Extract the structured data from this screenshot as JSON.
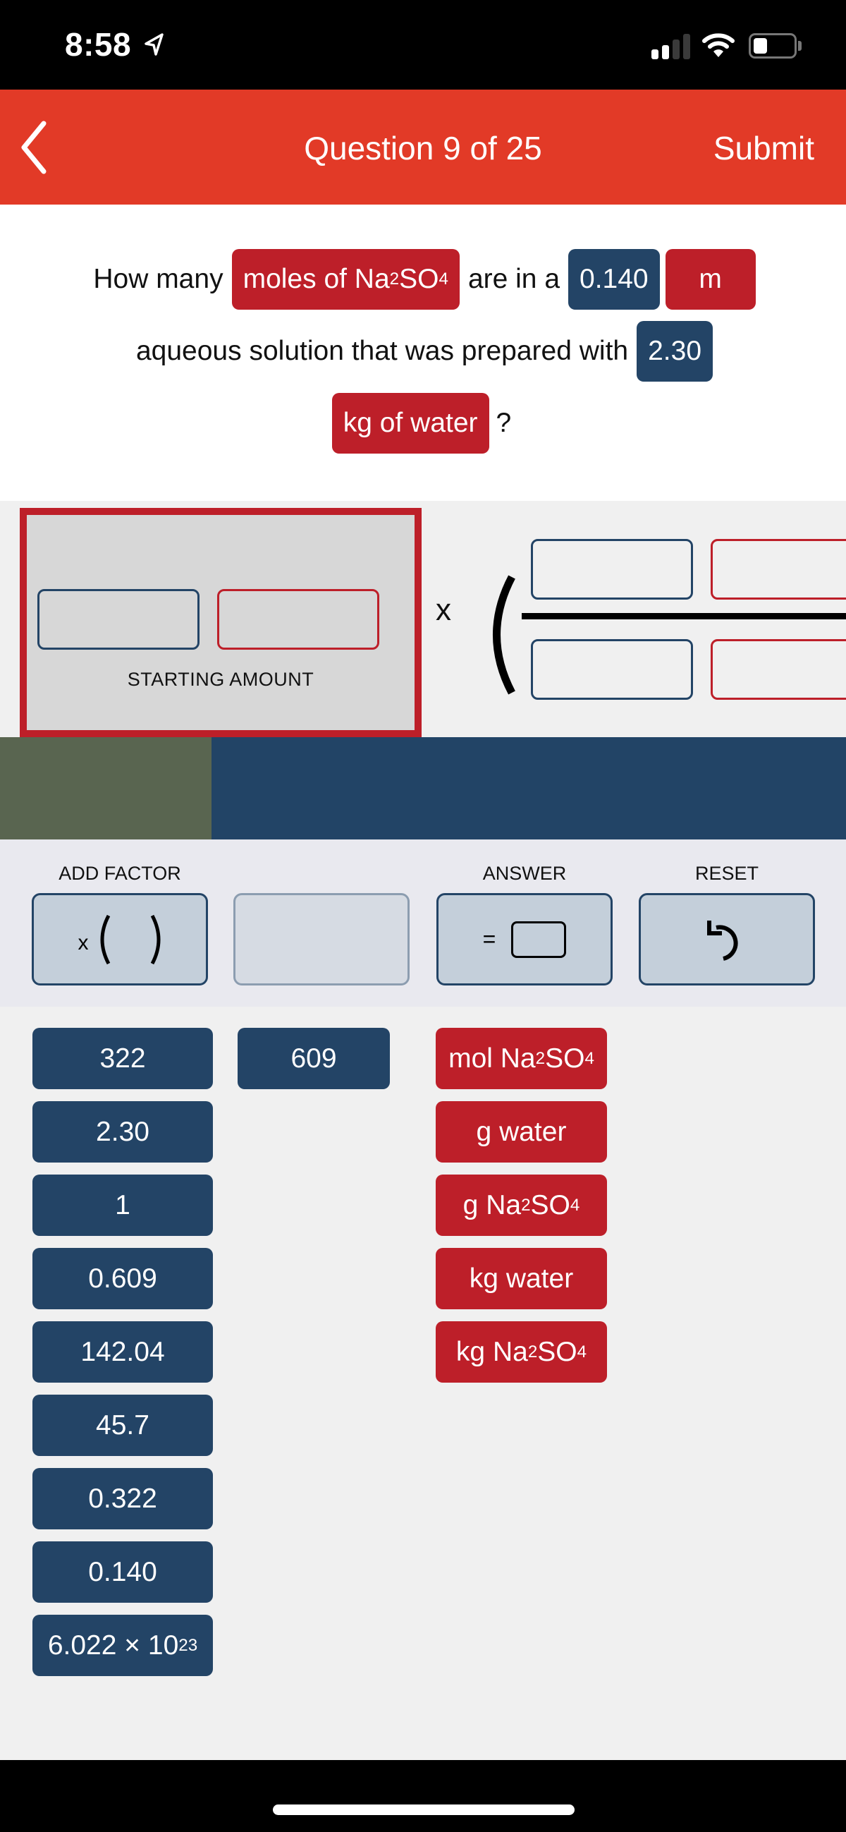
{
  "status_bar": {
    "time": "8:58",
    "location_icon": "location-arrow-icon",
    "signal_bars_active": 2,
    "signal_bars_total": 4,
    "wifi_icon": "wifi-icon",
    "battery_level_percent": 35
  },
  "nav": {
    "back_icon": "chevron-left-icon",
    "title": "Question 9 of 25",
    "submit_label": "Submit"
  },
  "question": {
    "line1": {
      "text1": "How many",
      "chip1": {
        "text": "moles of Na",
        "sub1": "2",
        "mid": "SO",
        "sub2": "4",
        "type": "unit"
      },
      "text2": "are in a",
      "chip2": {
        "text": "0.140",
        "type": "value"
      },
      "chip3": {
        "text": "m",
        "type": "unit"
      }
    },
    "line2": {
      "text1": "aqueous solution that was prepared with",
      "chip1": {
        "text": "2.30",
        "type": "value"
      }
    },
    "line3": {
      "chip1": {
        "text": "kg of water",
        "type": "unit"
      },
      "text1": "?"
    }
  },
  "workspace": {
    "starting_amount_label": "STARTING AMOUNT",
    "multiply_symbol": "x"
  },
  "progress": {
    "fraction_complete": 0.25
  },
  "toolbar": {
    "add_factor_label": "ADD FACTOR",
    "add_factor_symbol": "x",
    "answer_label": "ANSWER",
    "answer_symbol": "=",
    "reset_label": "RESET",
    "reset_icon": "undo-icon"
  },
  "tiles": {
    "values_col1": [
      "322",
      "2.30",
      "1",
      "0.609",
      "142.04",
      "45.7",
      "0.322",
      "0.140"
    ],
    "avogadro": {
      "base": "6.022 × 10",
      "exp": "23"
    },
    "values_col2": [
      "609"
    ],
    "units": [
      {
        "pre": "mol Na",
        "sub1": "2",
        "mid": "SO",
        "sub2": "4"
      },
      {
        "pre": "g water"
      },
      {
        "pre": "g Na",
        "sub1": "2",
        "mid": "SO",
        "sub2": "4"
      },
      {
        "pre": "kg water"
      },
      {
        "pre": "kg Na",
        "sub1": "2",
        "mid": "SO",
        "sub2": "4"
      }
    ]
  },
  "colors": {
    "nav_red": "#e23a27",
    "unit_red": "#bd1f29",
    "value_blue": "#234466",
    "progress_done": "#596550"
  }
}
